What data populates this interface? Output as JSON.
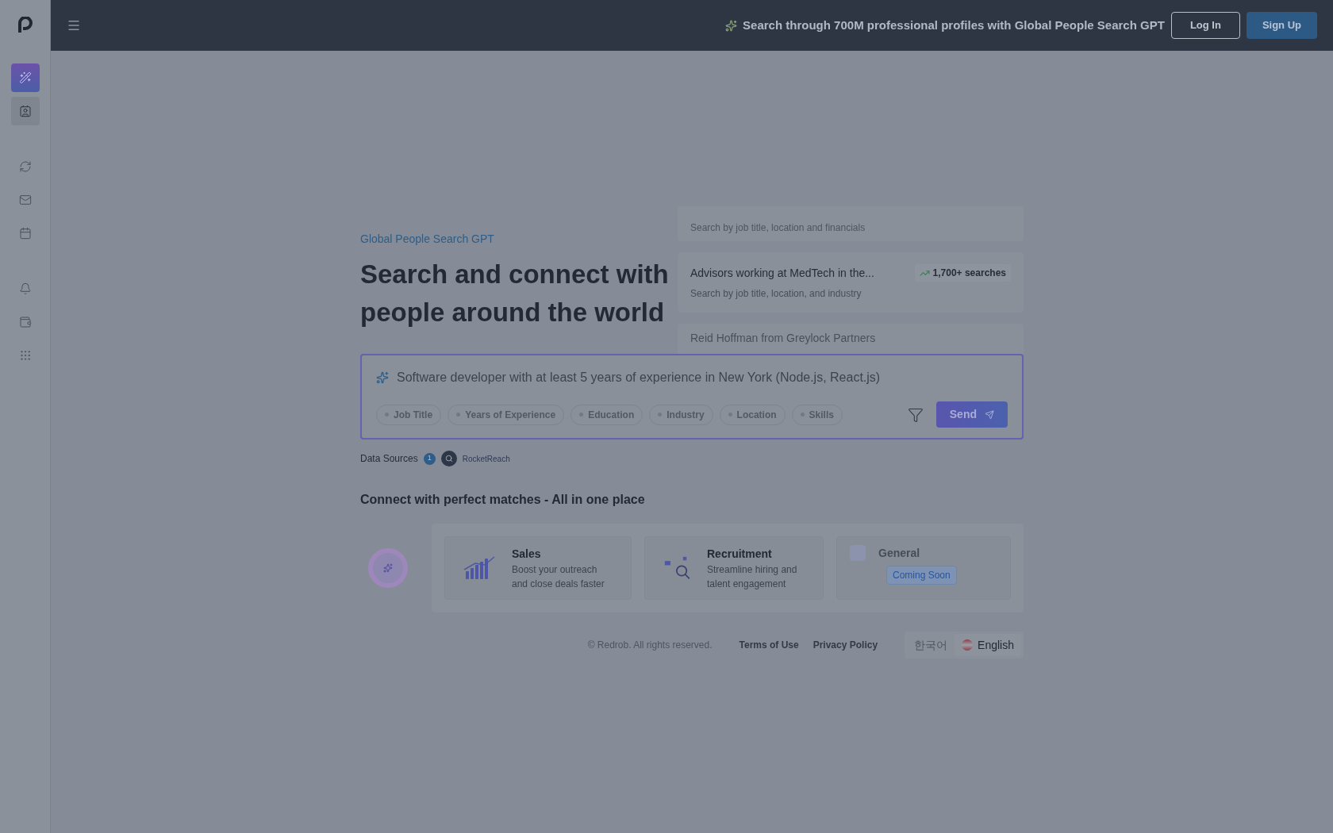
{
  "header": {
    "promo": "Search through 700M professional profiles with Global People Search GPT",
    "login": "Log In",
    "signup": "Sign Up"
  },
  "sidebar": {
    "items": [
      {
        "selected": true
      },
      {
        "selected": false
      },
      {
        "selected": false
      },
      {
        "selected": false
      },
      {
        "selected": false
      },
      {
        "selected": false
      },
      {
        "selected": false
      },
      {
        "selected": false
      }
    ]
  },
  "hero": {
    "eyebrow": "Global People Search GPT",
    "title": "Search and connect with people around the world"
  },
  "suggestions": [
    {
      "subtitle": "Search by job title, location and financials",
      "focused": false
    },
    {
      "title": "Advisors working at MedTech in the...",
      "subtitle": "Search by job title, location, and industry",
      "count": "1,700+ searches",
      "focused": true
    },
    {
      "title": "Reid Hoffman from Greylock Partners",
      "focused": false
    }
  ],
  "search": {
    "value": "Software developer with at least 5 years of experience in New York (Node.js, React.js)",
    "chips": [
      "Job Title",
      "Years of Experience",
      "Education",
      "Industry",
      "Location",
      "Skills"
    ],
    "send": "Send"
  },
  "data_sources": {
    "label": "Data Sources",
    "count": "1",
    "source": "RocketReach"
  },
  "matches": {
    "heading": "Connect with perfect matches - All in one place",
    "cards": [
      {
        "kind": "sales",
        "title": "Sales",
        "description": "Boost your outreach and close deals faster",
        "disabled": false
      },
      {
        "kind": "recruit",
        "title": "Recruitment",
        "description": "Streamline hiring and talent engagement",
        "disabled": false
      },
      {
        "kind": "general",
        "title": "General",
        "disabled": true,
        "badge": "Coming Soon"
      }
    ]
  },
  "footer": {
    "copyright": "© Redrob. All rights reserved.",
    "links": [
      "Terms of Use",
      "Privacy Policy"
    ],
    "languages": [
      {
        "label": "한국어",
        "selected": false
      },
      {
        "label": "English",
        "selected": true
      }
    ]
  }
}
